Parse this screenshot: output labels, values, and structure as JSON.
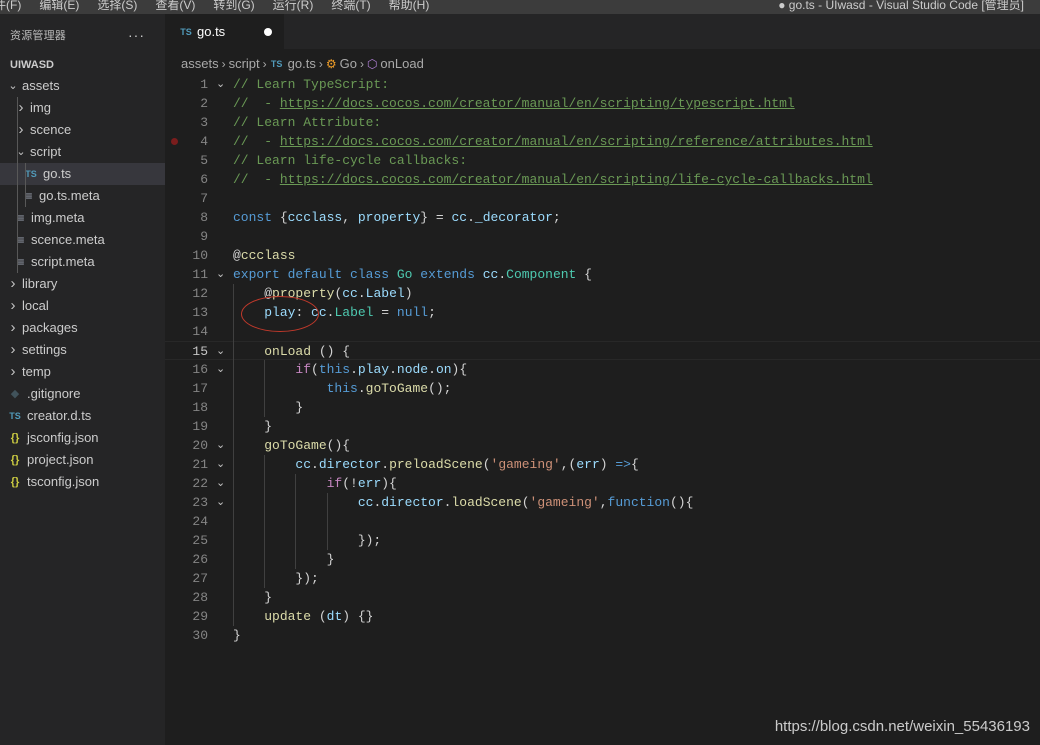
{
  "menu": [
    "件(F)",
    "编辑(E)",
    "选择(S)",
    "查看(V)",
    "转到(G)",
    "运行(R)",
    "终端(T)",
    "帮助(H)"
  ],
  "window_title": "● go.ts - UIwasd - Visual Studio Code [管理员]",
  "sidebar": {
    "title": "资源管理器",
    "more": "···",
    "root": "UIWASD",
    "items": [
      {
        "label": "assets",
        "icon": "chevron-down",
        "depth": 0
      },
      {
        "label": "img",
        "icon": "chevron-right",
        "depth": 1
      },
      {
        "label": "scence",
        "icon": "chevron-right",
        "depth": 1
      },
      {
        "label": "script",
        "icon": "chevron-down",
        "depth": 1
      },
      {
        "label": "go.ts",
        "icon": "ts-file",
        "badge": "TS",
        "depth": 2,
        "selected": true
      },
      {
        "label": "go.ts.meta",
        "icon": "meta-file",
        "depth": 2
      },
      {
        "label": "img.meta",
        "icon": "meta-file",
        "depth": 1
      },
      {
        "label": "scence.meta",
        "icon": "meta-file",
        "depth": 1
      },
      {
        "label": "script.meta",
        "icon": "meta-file",
        "depth": 1
      },
      {
        "label": "library",
        "icon": "chevron-right",
        "depth": 0
      },
      {
        "label": "local",
        "icon": "chevron-right",
        "depth": 0
      },
      {
        "label": "packages",
        "icon": "chevron-right",
        "depth": 0
      },
      {
        "label": "settings",
        "icon": "chevron-right",
        "depth": 0
      },
      {
        "label": "temp",
        "icon": "chevron-right",
        "depth": 0
      },
      {
        "label": ".gitignore",
        "icon": "git-file",
        "depth": 0
      },
      {
        "label": "creator.d.ts",
        "icon": "ts-file",
        "badge": "TS",
        "depth": 0
      },
      {
        "label": "jsconfig.json",
        "icon": "json-file",
        "badge": "{}",
        "depth": 0
      },
      {
        "label": "project.json",
        "icon": "json-file",
        "badge": "{}",
        "depth": 0
      },
      {
        "label": "tsconfig.json",
        "icon": "json-file",
        "badge": "{}",
        "depth": 0
      }
    ]
  },
  "tab": {
    "badge": "TS",
    "label": "go.ts",
    "modified": true
  },
  "breadcrumb": [
    "assets",
    "script",
    "go.ts",
    "Go",
    "onLoad"
  ],
  "editor": {
    "active_line": 15,
    "breakpoint_line": 4,
    "lines": [
      {
        "n": 1,
        "fold": "v",
        "tokens": [
          [
            "com",
            "// Learn TypeScript:"
          ]
        ]
      },
      {
        "n": 2,
        "tokens": [
          [
            "com",
            "//  - "
          ],
          [
            "link",
            "https://docs.cocos.com/creator/manual/en/scripting/typescript.html"
          ]
        ]
      },
      {
        "n": 3,
        "tokens": [
          [
            "com",
            "// Learn Attribute:"
          ]
        ]
      },
      {
        "n": 4,
        "tokens": [
          [
            "com",
            "//  - "
          ],
          [
            "link",
            "https://docs.cocos.com/creator/manual/en/scripting/reference/attributes.html"
          ]
        ]
      },
      {
        "n": 5,
        "tokens": [
          [
            "com",
            "// Learn life-cycle callbacks:"
          ]
        ]
      },
      {
        "n": 6,
        "tokens": [
          [
            "com",
            "//  - "
          ],
          [
            "link",
            "https://docs.cocos.com/creator/manual/en/scripting/life-cycle-callbacks.html"
          ]
        ]
      },
      {
        "n": 7,
        "tokens": []
      },
      {
        "n": 8,
        "tokens": [
          [
            "kw",
            "const"
          ],
          [
            "txt",
            " {"
          ],
          [
            "var",
            "ccclass"
          ],
          [
            "txt",
            ", "
          ],
          [
            "var",
            "property"
          ],
          [
            "txt",
            "} = "
          ],
          [
            "var",
            "cc"
          ],
          [
            "txt",
            "."
          ],
          [
            "var",
            "_decorator"
          ],
          [
            "txt",
            ";"
          ]
        ]
      },
      {
        "n": 9,
        "tokens": []
      },
      {
        "n": 10,
        "tokens": [
          [
            "txt",
            "@"
          ],
          [
            "fn",
            "ccclass"
          ]
        ]
      },
      {
        "n": 11,
        "fold": "v",
        "tokens": [
          [
            "kw",
            "export"
          ],
          [
            "txt",
            " "
          ],
          [
            "kw",
            "default"
          ],
          [
            "txt",
            " "
          ],
          [
            "kw",
            "class"
          ],
          [
            "txt",
            " "
          ],
          [
            "type",
            "Go"
          ],
          [
            "txt",
            " "
          ],
          [
            "kw",
            "extends"
          ],
          [
            "txt",
            " "
          ],
          [
            "var",
            "cc"
          ],
          [
            "txt",
            "."
          ],
          [
            "type",
            "Component"
          ],
          [
            "txt",
            " {"
          ]
        ]
      },
      {
        "n": 12,
        "tokens": [
          [
            "txt",
            "    @"
          ],
          [
            "fn",
            "property"
          ],
          [
            "txt",
            "("
          ],
          [
            "var",
            "cc"
          ],
          [
            "txt",
            "."
          ],
          [
            "var",
            "Label"
          ],
          [
            "txt",
            ")"
          ]
        ]
      },
      {
        "n": 13,
        "tokens": [
          [
            "txt",
            "    "
          ],
          [
            "var",
            "play"
          ],
          [
            "txt",
            ": "
          ],
          [
            "var",
            "cc"
          ],
          [
            "txt",
            "."
          ],
          [
            "type",
            "Label"
          ],
          [
            "txt",
            " = "
          ],
          [
            "kw",
            "null"
          ],
          [
            "txt",
            ";"
          ]
        ]
      },
      {
        "n": 14,
        "tokens": []
      },
      {
        "n": 15,
        "fold": "v",
        "tokens": [
          [
            "txt",
            "    "
          ],
          [
            "fn",
            "onLoad"
          ],
          [
            "txt",
            " () {"
          ]
        ]
      },
      {
        "n": 16,
        "fold": "v",
        "tokens": [
          [
            "txt",
            "        "
          ],
          [
            "ctl",
            "if"
          ],
          [
            "txt",
            "("
          ],
          [
            "kw",
            "this"
          ],
          [
            "txt",
            "."
          ],
          [
            "var",
            "play"
          ],
          [
            "txt",
            "."
          ],
          [
            "var",
            "node"
          ],
          [
            "txt",
            "."
          ],
          [
            "var",
            "on"
          ],
          [
            "txt",
            "){"
          ]
        ]
      },
      {
        "n": 17,
        "tokens": [
          [
            "txt",
            "            "
          ],
          [
            "kw",
            "this"
          ],
          [
            "txt",
            "."
          ],
          [
            "fn",
            "goToGame"
          ],
          [
            "txt",
            "();"
          ]
        ]
      },
      {
        "n": 18,
        "tokens": [
          [
            "txt",
            "        }"
          ]
        ]
      },
      {
        "n": 19,
        "tokens": [
          [
            "txt",
            "    }"
          ]
        ]
      },
      {
        "n": 20,
        "fold": "v",
        "tokens": [
          [
            "txt",
            "    "
          ],
          [
            "fn",
            "goToGame"
          ],
          [
            "txt",
            "(){"
          ]
        ]
      },
      {
        "n": 21,
        "fold": "v",
        "tokens": [
          [
            "txt",
            "        "
          ],
          [
            "var",
            "cc"
          ],
          [
            "txt",
            "."
          ],
          [
            "var",
            "director"
          ],
          [
            "txt",
            "."
          ],
          [
            "fn",
            "preloadScene"
          ],
          [
            "txt",
            "("
          ],
          [
            "str",
            "'gameing'"
          ],
          [
            "txt",
            ",("
          ],
          [
            "var",
            "err"
          ],
          [
            "txt",
            ") "
          ],
          [
            "kw",
            "=>"
          ],
          [
            "txt",
            "{"
          ]
        ]
      },
      {
        "n": 22,
        "fold": "v",
        "tokens": [
          [
            "txt",
            "            "
          ],
          [
            "ctl",
            "if"
          ],
          [
            "txt",
            "(!"
          ],
          [
            "var",
            "err"
          ],
          [
            "txt",
            "){"
          ]
        ]
      },
      {
        "n": 23,
        "fold": "v",
        "tokens": [
          [
            "txt",
            "                "
          ],
          [
            "var",
            "cc"
          ],
          [
            "txt",
            "."
          ],
          [
            "var",
            "director"
          ],
          [
            "txt",
            "."
          ],
          [
            "fn",
            "loadScene"
          ],
          [
            "txt",
            "("
          ],
          [
            "str",
            "'gameing'"
          ],
          [
            "txt",
            ","
          ],
          [
            "kw",
            "function"
          ],
          [
            "txt",
            "(){"
          ]
        ]
      },
      {
        "n": 24,
        "tokens": []
      },
      {
        "n": 25,
        "tokens": [
          [
            "txt",
            "                });"
          ]
        ]
      },
      {
        "n": 26,
        "tokens": [
          [
            "txt",
            "            }"
          ]
        ]
      },
      {
        "n": 27,
        "tokens": [
          [
            "txt",
            "        });"
          ]
        ]
      },
      {
        "n": 28,
        "tokens": [
          [
            "txt",
            "    }"
          ]
        ]
      },
      {
        "n": 29,
        "tokens": [
          [
            "txt",
            "    "
          ],
          [
            "fn",
            "update"
          ],
          [
            "txt",
            " ("
          ],
          [
            "var",
            "dt"
          ],
          [
            "txt",
            ") {}"
          ]
        ]
      },
      {
        "n": 30,
        "tokens": [
          [
            "txt",
            "}"
          ]
        ]
      }
    ]
  },
  "watermark": "https://blog.csdn.net/weixin_55436193",
  "colors": {
    "accent_red": "#c0392b",
    "ts_blue": "#519aba",
    "json_yellow": "#cbcb41"
  }
}
